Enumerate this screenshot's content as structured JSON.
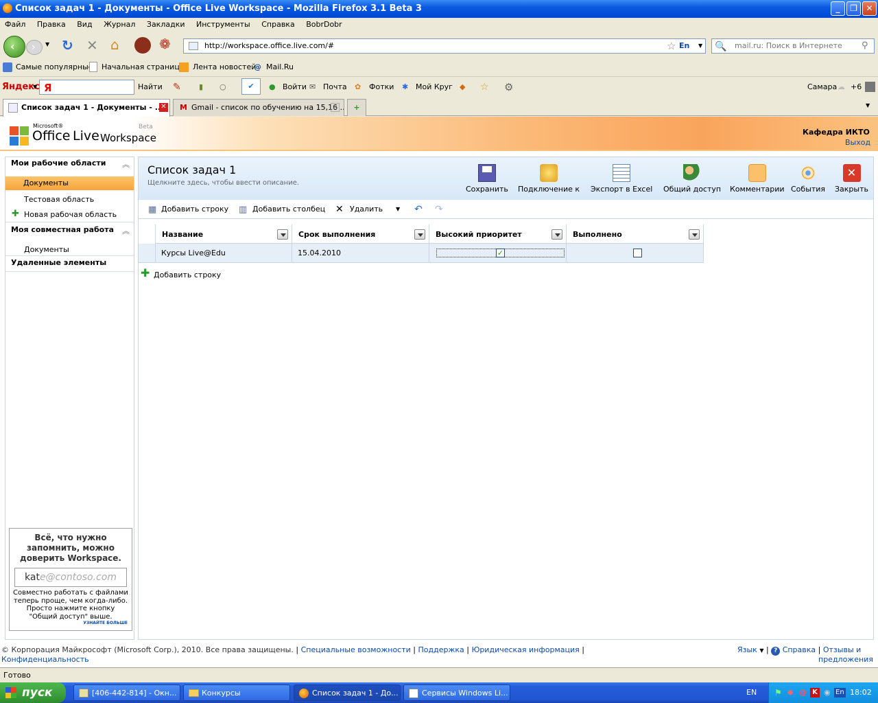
{
  "window": {
    "title": "Список задач 1 - Документы - Office Live Workspace - Mozilla Firefox 3.1 Beta 3"
  },
  "menu": [
    "Файл",
    "Правка",
    "Вид",
    "Журнал",
    "Закладки",
    "Инструменты",
    "Справка",
    "BobrDobr"
  ],
  "nav": {
    "url": "http://workspace.office.live.com/#",
    "lang_badge": "En",
    "search_placeholder": "mail.ru: Поиск в Интернете"
  },
  "bookmarks": [
    "Самые популярные",
    "Начальная страница",
    "Лента новостей",
    "Mail.Ru"
  ],
  "yandex": {
    "brand": "Яндекс",
    "logo": "Я",
    "find": "Найти",
    "login": "Войти",
    "mail": "Почта",
    "photos": "Фотки",
    "circle": "Мой Круг",
    "city": "Самара",
    "temp": "+6"
  },
  "tabs": [
    {
      "label": "Список задач 1 - Документы - ..."
    },
    {
      "label": "Gmail - список по обучению на 15,16 ..."
    }
  ],
  "header": {
    "microsoft": "Microsoft®",
    "office": "Office",
    "live": "Live",
    "workspace": "Workspace",
    "beta": "Beta",
    "user": "Кафедра ИКТО",
    "logout": "Выход"
  },
  "sidebar": {
    "section1": "Мои рабочие области",
    "items1": [
      "Документы",
      "Тестовая область"
    ],
    "new_area": "Новая рабочая область",
    "section2": "Моя совместная работа",
    "items2": [
      "Документы"
    ],
    "section3": "Удаленные элементы"
  },
  "promo": {
    "headline": "Всё, что нужно запомнить, можно доверить Workspace.",
    "email_typed": "kat",
    "email_rest": "e@contoso.com",
    "body": "Совместно работать с файлами теперь проще, чем когда-либо. Просто нажмите кнопку \"Общий доступ\" выше.",
    "more": "УЗНАЙТЕ БОЛЬШЕ"
  },
  "doc": {
    "title": "Список задач 1",
    "desc_placeholder": "Щелкните здесь, чтобы ввести описание."
  },
  "toolbar": [
    "Сохранить",
    "Подключение к",
    "Экспорт в Excel",
    "Общий доступ",
    "Комментарии",
    "События",
    "Закрыть"
  ],
  "actions": {
    "add_row": "Добавить строку",
    "add_col": "Добавить столбец",
    "delete": "Удалить"
  },
  "grid": {
    "columns": [
      "Название",
      "Срок выполнения",
      "Высокий приоритет",
      "Выполнено"
    ],
    "rows": [
      {
        "name": "Курсы Live@Edu",
        "due": "15.04.2010",
        "high_priority": true,
        "done": false
      }
    ],
    "add_row": "Добавить строку"
  },
  "footer": {
    "copyright": "© Корпорация Майкрософт (Microsoft Corp.), 2010. Все права защищены.",
    "accessibility": "Специальные возможности",
    "support": "Поддержка",
    "legal": "Юридическая информация",
    "privacy": "Конфиденциальность",
    "language": "Язык",
    "help": "Справка",
    "feedback1": "Отзывы и",
    "feedback2": "предложения"
  },
  "status": "Готово",
  "taskbar": {
    "start": "пуск",
    "tasks": [
      "[406-442-814] - Окн...",
      "Конкурсы",
      "Список задач 1 - До...",
      "Сервисы Windows Li..."
    ],
    "lang": "EN",
    "tray_lang": "En",
    "clock": "18:02"
  },
  "colors": {
    "accent_orange": "#f9a45c",
    "link_blue": "#0a4aa8",
    "xp_blue": "#245ddb"
  }
}
